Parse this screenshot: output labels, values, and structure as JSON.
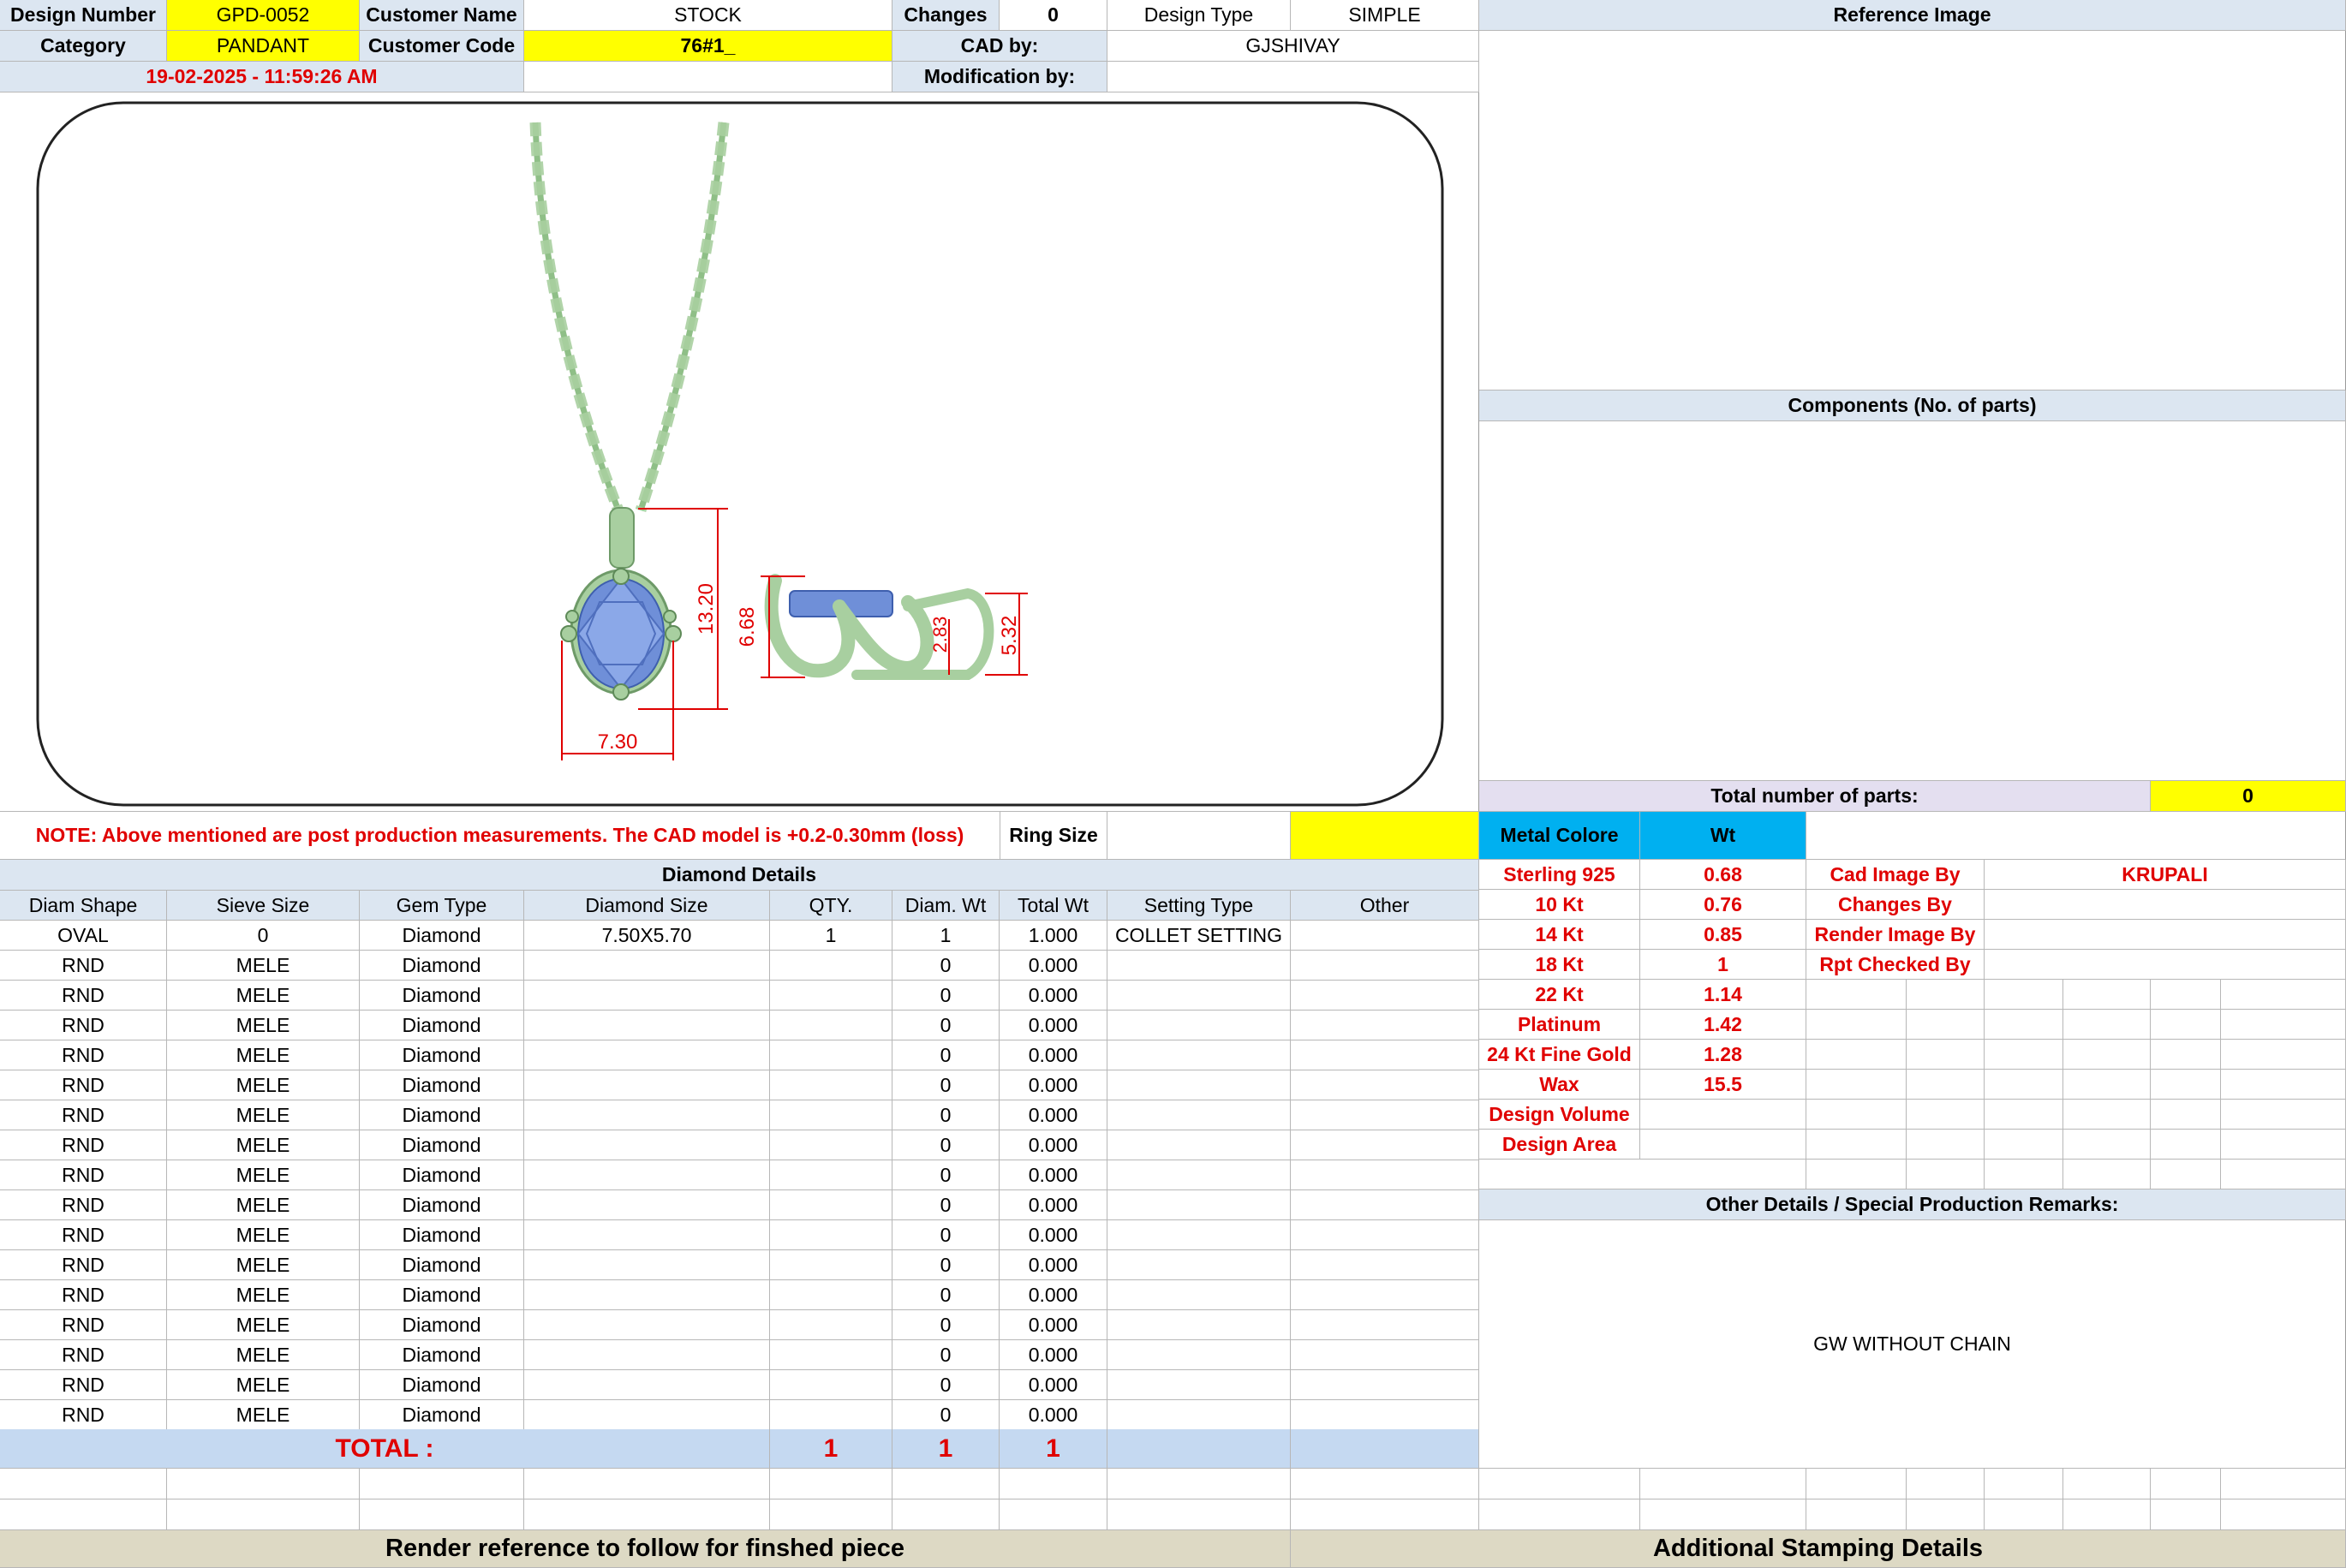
{
  "header": {
    "design_number_label": "Design Number",
    "design_number": "GPD-0052",
    "customer_name_label": "Customer Name",
    "customer_name": "STOCK",
    "changes_label": "Changes",
    "changes": "0",
    "design_type_label": "Design Type",
    "design_type": "SIMPLE",
    "category_label": "Category",
    "category": "PANDANT",
    "customer_code_label": "Customer Code",
    "customer_code": "76#1_",
    "cad_by_label": "CAD by:",
    "cad_by": "GJSHIVAY",
    "timestamp": "19-02-2025 - 11:59:26 AM",
    "modification_by_label": "Modification by:",
    "modification_by": ""
  },
  "drawing": {
    "dimensions": {
      "height": "13.20",
      "width": "7.30",
      "side_height": "6.68",
      "bail": "2.83",
      "side_depth": "5.32"
    },
    "colors": {
      "metal": "#a8cfa0",
      "stone": "#6f8fd8",
      "dimension": "#e00000"
    }
  },
  "right_panel": {
    "reference_image_label": "Reference Image",
    "components_label": "Components (No. of parts)",
    "total_parts_label": "Total number of parts:",
    "total_parts": "0"
  },
  "note": {
    "text": "NOTE: Above mentioned are post production measurements. The CAD model is +0.2-0.30mm (loss)",
    "ring_size_label": "Ring Size",
    "ring_size": ""
  },
  "diamond_details": {
    "title": "Diamond Details",
    "columns": [
      "Diam Shape",
      "Sieve Size",
      "Gem Type",
      "Diamond Size",
      "QTY.",
      "Diam. Wt",
      "Total Wt",
      "Setting Type",
      "Other"
    ],
    "rows": [
      [
        "OVAL",
        "0",
        "Diamond",
        "7.50X5.70",
        "1",
        "1",
        "1.000",
        "COLLET SETTING",
        ""
      ],
      [
        "RND",
        "MELE",
        "Diamond",
        "",
        "",
        "0",
        "0.000",
        "",
        ""
      ],
      [
        "RND",
        "MELE",
        "Diamond",
        "",
        "",
        "0",
        "0.000",
        "",
        ""
      ],
      [
        "RND",
        "MELE",
        "Diamond",
        "",
        "",
        "0",
        "0.000",
        "",
        ""
      ],
      [
        "RND",
        "MELE",
        "Diamond",
        "",
        "",
        "0",
        "0.000",
        "",
        ""
      ],
      [
        "RND",
        "MELE",
        "Diamond",
        "",
        "",
        "0",
        "0.000",
        "",
        ""
      ],
      [
        "RND",
        "MELE",
        "Diamond",
        "",
        "",
        "0",
        "0.000",
        "",
        ""
      ],
      [
        "RND",
        "MELE",
        "Diamond",
        "",
        "",
        "0",
        "0.000",
        "",
        ""
      ],
      [
        "RND",
        "MELE",
        "Diamond",
        "",
        "",
        "0",
        "0.000",
        "",
        ""
      ],
      [
        "RND",
        "MELE",
        "Diamond",
        "",
        "",
        "0",
        "0.000",
        "",
        ""
      ],
      [
        "RND",
        "MELE",
        "Diamond",
        "",
        "",
        "0",
        "0.000",
        "",
        ""
      ],
      [
        "RND",
        "MELE",
        "Diamond",
        "",
        "",
        "0",
        "0.000",
        "",
        ""
      ],
      [
        "RND",
        "MELE",
        "Diamond",
        "",
        "",
        "0",
        "0.000",
        "",
        ""
      ],
      [
        "RND",
        "MELE",
        "Diamond",
        "",
        "",
        "0",
        "0.000",
        "",
        ""
      ],
      [
        "RND",
        "MELE",
        "Diamond",
        "",
        "",
        "0",
        "0.000",
        "",
        ""
      ],
      [
        "RND",
        "MELE",
        "Diamond",
        "",
        "",
        "0",
        "0.000",
        "",
        ""
      ],
      [
        "RND",
        "MELE",
        "Diamond",
        "",
        "",
        "0",
        "0.000",
        "",
        ""
      ]
    ],
    "total_label": "TOTAL :",
    "total_qty": "1",
    "total_diam_wt": "1",
    "total_wt": "1"
  },
  "metal": {
    "metal_colore_label": "Metal Colore",
    "wt_label": "Wt",
    "rows": [
      [
        "Sterling 925",
        "0.68"
      ],
      [
        "10 Kt",
        "0.76"
      ],
      [
        "14 Kt",
        "0.85"
      ],
      [
        "18 Kt",
        "1"
      ],
      [
        "22 Kt",
        "1.14"
      ],
      [
        "Platinum",
        "1.42"
      ],
      [
        "24 Kt Fine Gold",
        "1.28"
      ],
      [
        "Wax",
        "15.5"
      ],
      [
        "Design Volume",
        ""
      ],
      [
        "Design Area",
        ""
      ]
    ]
  },
  "people": {
    "cad_image_by_label": "Cad Image By",
    "cad_image_by": "KRUPALI",
    "changes_by_label": "Changes By",
    "changes_by": "",
    "render_image_by_label": "Render Image By",
    "render_image_by": "",
    "rpt_checked_by_label": "Rpt Checked By",
    "rpt_checked_by": ""
  },
  "remarks": {
    "title": "Other Details / Special Production Remarks:",
    "text": "GW WITHOUT CHAIN"
  },
  "footer": {
    "render_reference": "Render reference to follow for finshed piece",
    "stamping": "Additional Stamping Details"
  }
}
